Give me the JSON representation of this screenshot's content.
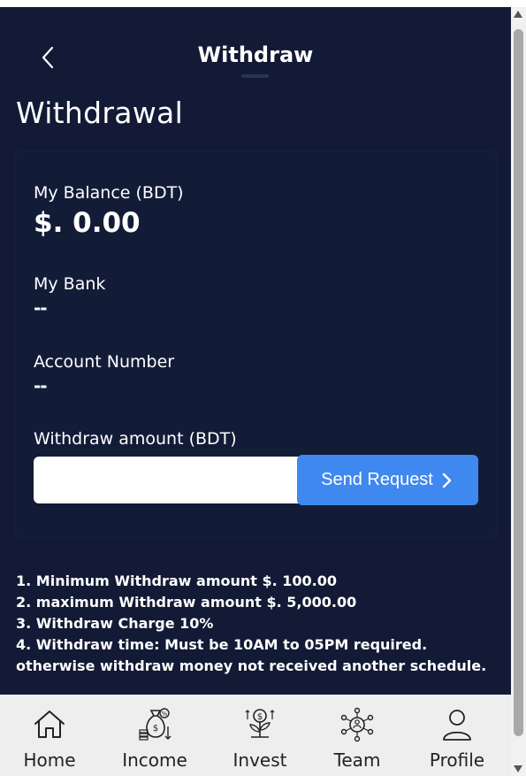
{
  "header": {
    "title": "Withdraw"
  },
  "page": {
    "heading": "Withdrawal"
  },
  "card": {
    "balance_label": "My Balance (BDT)",
    "balance_value": "$. 0.00",
    "bank_label": "My Bank",
    "bank_value": "--",
    "account_label": "Account Number",
    "account_value": "--",
    "amount_label": "Withdraw amount (BDT)",
    "amount_value": "",
    "amount_placeholder": "",
    "send_label": "Send Request"
  },
  "rules": [
    "1. Minimum Withdraw amount $. 100.00",
    "2. maximum Withdraw amount $. 5,000.00",
    "3. Withdraw Charge 10%",
    "4. Withdraw time: Must be 10AM to 05PM required. otherwise withdraw money not received another schedule."
  ],
  "nav": {
    "items": [
      {
        "label": "Home",
        "icon": "home-icon"
      },
      {
        "label": "Income",
        "icon": "money-bag-icon"
      },
      {
        "label": "Invest",
        "icon": "plant-coin-icon"
      },
      {
        "label": "Team",
        "icon": "network-icon"
      },
      {
        "label": "Profile",
        "icon": "user-icon"
      }
    ]
  },
  "colors": {
    "background": "#121a35",
    "card": "#131c37",
    "accent": "#3f88f0",
    "nav_background": "#eeeeee"
  }
}
